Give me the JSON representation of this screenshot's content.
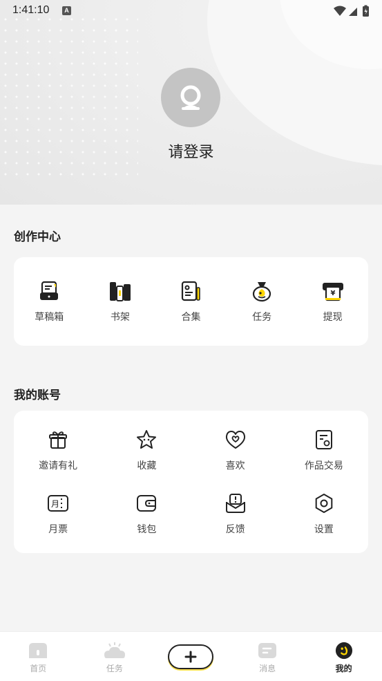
{
  "status_bar": {
    "time": "1:41:10",
    "badge": "A"
  },
  "profile": {
    "login_text": "请登录"
  },
  "creation_center": {
    "title": "创作中心",
    "items": [
      {
        "label": "草稿箱",
        "icon": "drafts-icon"
      },
      {
        "label": "书架",
        "icon": "bookshelf-icon"
      },
      {
        "label": "合集",
        "icon": "collection-icon"
      },
      {
        "label": "任务",
        "icon": "task-bag-icon"
      },
      {
        "label": "提现",
        "icon": "withdraw-icon"
      }
    ]
  },
  "my_account": {
    "title": "我的账号",
    "items": [
      {
        "label": "邀请有礼",
        "icon": "gift-icon"
      },
      {
        "label": "收藏",
        "icon": "star-icon"
      },
      {
        "label": "喜欢",
        "icon": "heart-icon"
      },
      {
        "label": "作品交易",
        "icon": "trade-icon"
      },
      {
        "label": "月票",
        "icon": "monthly-ticket-icon"
      },
      {
        "label": "钱包",
        "icon": "wallet-icon"
      },
      {
        "label": "反馈",
        "icon": "feedback-icon"
      },
      {
        "label": "设置",
        "icon": "settings-icon"
      }
    ]
  },
  "bottom_nav": {
    "items": [
      {
        "label": "首页"
      },
      {
        "label": "任务"
      },
      {
        "label": ""
      },
      {
        "label": "消息"
      },
      {
        "label": "我的"
      }
    ],
    "active_index": 4
  },
  "colors": {
    "accent": "#FFD600",
    "dark": "#222222",
    "muted": "#AAAAAA"
  }
}
